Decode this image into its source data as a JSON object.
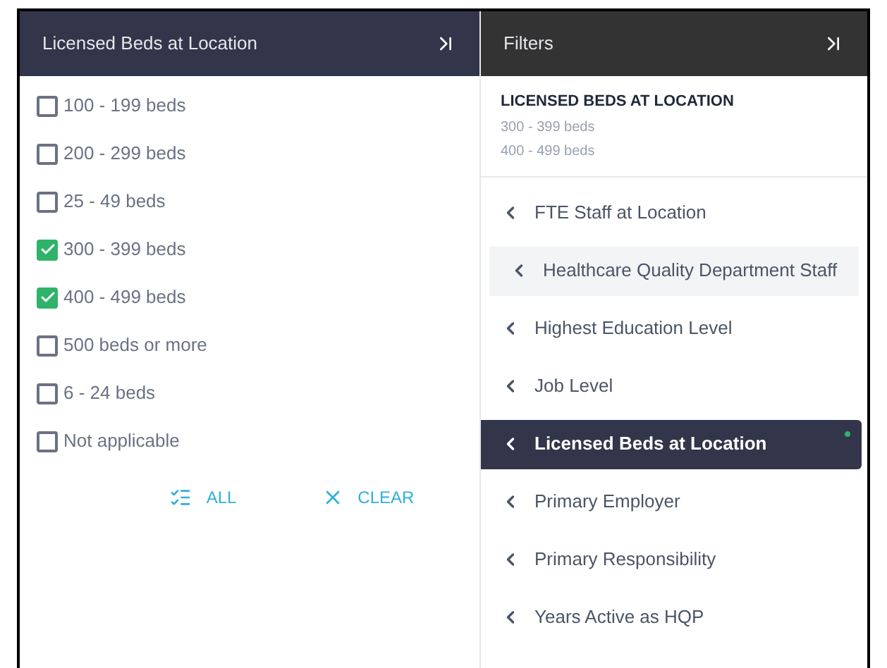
{
  "left_panel": {
    "title": "Licensed Beds at Location",
    "options": [
      {
        "label": "100 - 199 beds",
        "checked": false
      },
      {
        "label": "200 - 299 beds",
        "checked": false
      },
      {
        "label": "25 - 49 beds",
        "checked": false
      },
      {
        "label": "300 - 399 beds",
        "checked": true
      },
      {
        "label": "400 - 499 beds",
        "checked": true
      },
      {
        "label": "500 beds or more",
        "checked": false
      },
      {
        "label": "6 - 24 beds",
        "checked": false
      },
      {
        "label": "Not applicable",
        "checked": false
      }
    ],
    "actions": [
      {
        "kind": "all",
        "label": "ALL"
      },
      {
        "kind": "clear",
        "label": "CLEAR"
      }
    ]
  },
  "right_panel": {
    "title": "Filters",
    "summary": {
      "heading": "LICENSED BEDS AT LOCATION",
      "values": [
        "300 - 399 beds",
        "400 - 499 beds"
      ]
    },
    "items": [
      {
        "label": "FTE Staff at Location",
        "selected": false,
        "hovered": false,
        "filtered": false
      },
      {
        "label": "Healthcare Quality Department Staff",
        "selected": false,
        "hovered": true,
        "filtered": false
      },
      {
        "label": "Highest Education Level",
        "selected": false,
        "hovered": false,
        "filtered": false
      },
      {
        "label": "Job Level",
        "selected": false,
        "hovered": false,
        "filtered": false
      },
      {
        "label": "Licensed Beds at Location",
        "selected": true,
        "hovered": false,
        "filtered": true
      },
      {
        "label": "Primary Employer",
        "selected": false,
        "hovered": false,
        "filtered": false
      },
      {
        "label": "Primary Responsibility",
        "selected": false,
        "hovered": false,
        "filtered": false
      },
      {
        "label": "Years Active as HQP",
        "selected": false,
        "hovered": false,
        "filtered": false
      }
    ]
  }
}
